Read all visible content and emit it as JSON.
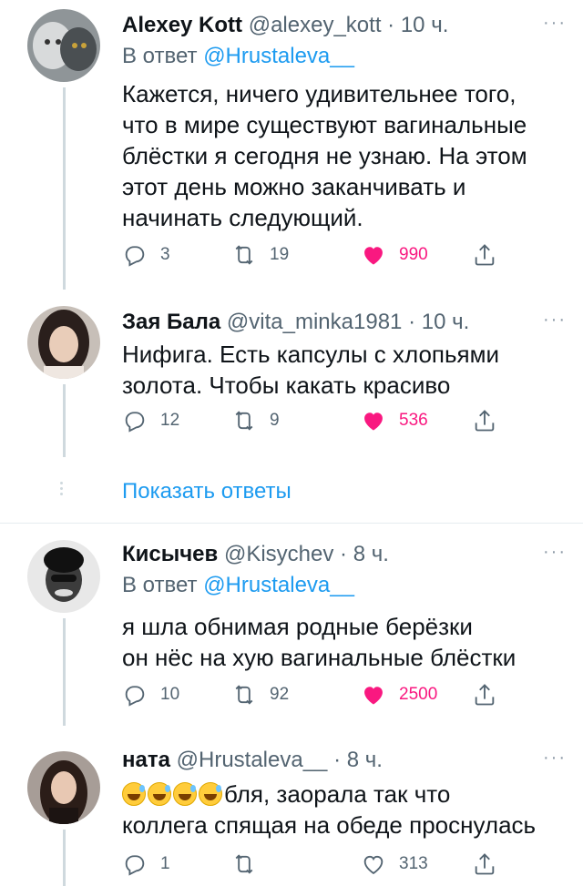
{
  "tweets": [
    {
      "name": "Alexey Kott",
      "handle": "@alexey_kott",
      "time": "· 10 ч.",
      "reply_prefix": "В ответ",
      "reply_mention": "@Hrustaleva__",
      "text": "Кажется, ничего удивительнее того, что в мире существуют вагинальные блёстки я сегодня не узнаю. На этом этот день можно заканчивать и начинать следующий.",
      "replies": "3",
      "retweets": "19",
      "likes": "990"
    },
    {
      "name": "Зая Бала",
      "handle": "@vita_minka1981",
      "time": "· 10 ч.",
      "text": "Нифига. Есть капсулы с хлопьями золота. Чтобы какать красиво",
      "replies": "12",
      "retweets": "9",
      "likes": "536"
    },
    {
      "name": "Кисычев",
      "handle": "@Kisychev",
      "time": "· 8 ч.",
      "reply_prefix": "В ответ",
      "reply_mention": "@Hrustaleva__",
      "text_line1": "я шла обнимая родные берёзки",
      "text_line2": "он нёс на хую вагинальные блёстки",
      "replies": "10",
      "retweets": "92",
      "likes": "2500"
    },
    {
      "name": "ната",
      "handle": "@Hrustaleva__",
      "time": "· 8 ч.",
      "text_line1": "бля, заорала так что",
      "text_line2": "коллега спящая на обеде проснулась",
      "replies": "1",
      "retweets": "",
      "likes": "313"
    }
  ],
  "show_replies": "Показать ответы",
  "more_glyph": "···",
  "colors": {
    "accent": "#1d9bf0",
    "like": "#f91880",
    "muted": "#536471"
  }
}
